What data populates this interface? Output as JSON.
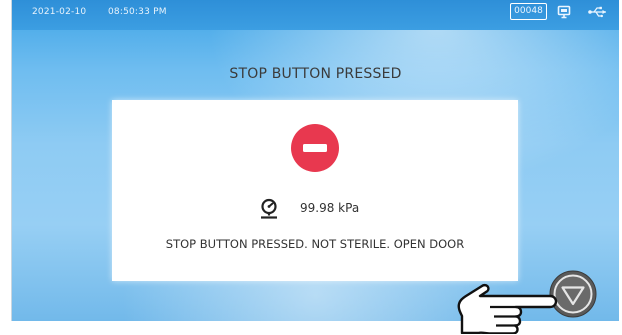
{
  "status_bar": {
    "date": "2021-02-10",
    "time": "08:50:33 PM",
    "counter": "00048",
    "icons": [
      "screen-share-icon",
      "usb-icon"
    ]
  },
  "headline": "STOP BUTTON PRESSED",
  "card": {
    "status_icon": "stop-icon",
    "pressure_icon": "pressure-gauge-icon",
    "pressure": "99.98 kPa",
    "message": "STOP BUTTON PRESSED. NOT STERILE. OPEN DOOR"
  },
  "stop_button": {
    "icon": "stop-triangle-icon"
  },
  "colors": {
    "stop_red": "#e8384f",
    "background_blue": "#6fbdf0"
  }
}
